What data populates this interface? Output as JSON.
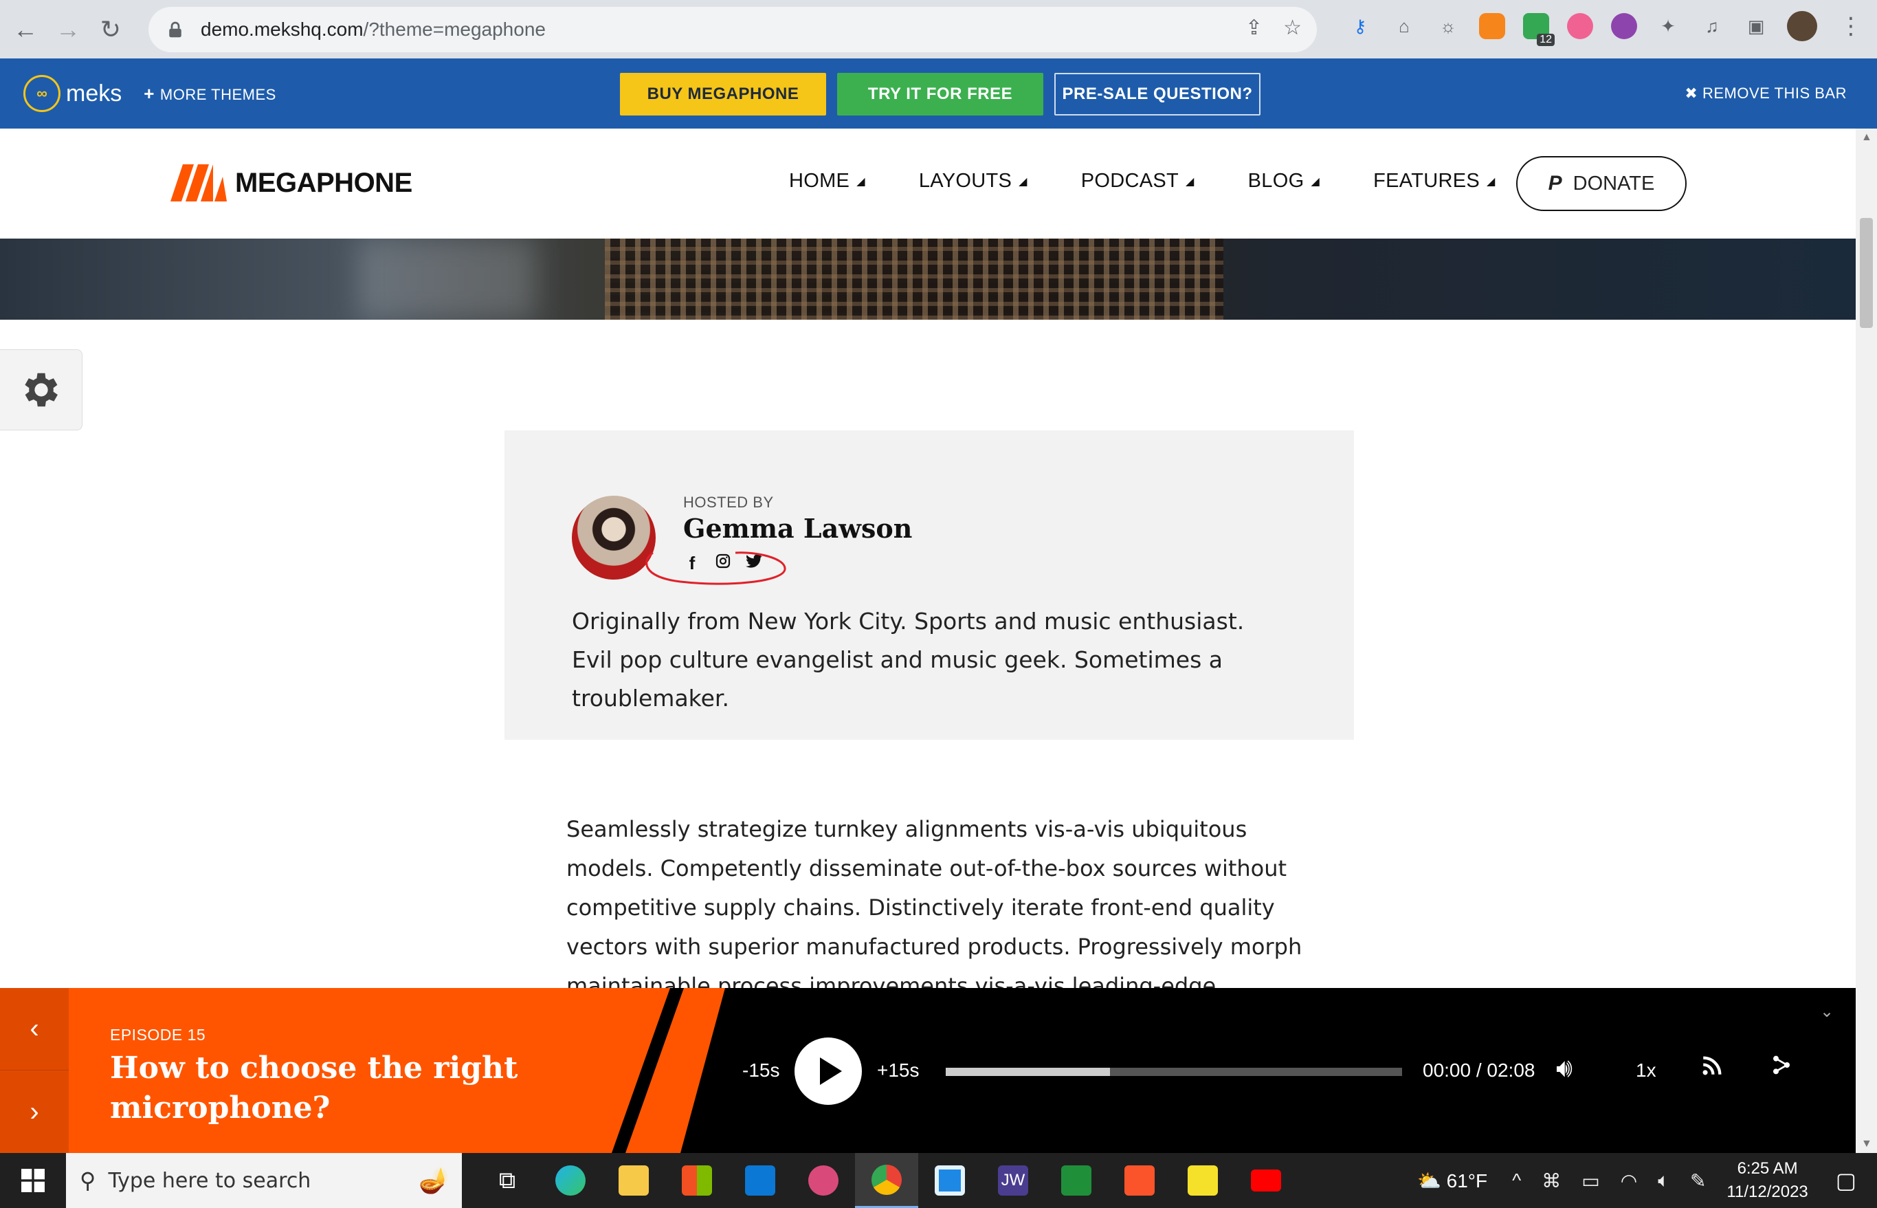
{
  "browser": {
    "url_host": "demo.mekshq.com",
    "url_rest": "/?theme=megaphone",
    "extension_badge": "12"
  },
  "meks_bar": {
    "brand": "meks",
    "more_themes": "MORE THEMES",
    "buy": "BUY MEGAPHONE",
    "try": "TRY IT FOR FREE",
    "presale": "PRE-SALE QUESTION?",
    "remove": "REMOVE THIS BAR"
  },
  "site": {
    "logo_text": "MEGAPHONE",
    "nav": [
      "HOME",
      "LAYOUTS",
      "PODCAST",
      "BLOG",
      "FEATURES"
    ],
    "donate": "DONATE"
  },
  "host": {
    "hosted_by": "HOSTED BY",
    "name": "Gemma Lawson",
    "bio": "Originally from New York City. Sports and music enthusiast. Evil pop culture evangelist and music geek. Sometimes a troublemaker."
  },
  "article": {
    "text": "Seamlessly strategize turnkey alignments vis-a-vis ubiquitous models. Competently disseminate out-of-the-box sources without competitive supply chains. Distinctively iterate front-end quality vectors with superior manufactured products. Progressively morph maintainable process improvements vis-a-vis leading-edge materials. Objectively"
  },
  "player": {
    "episode_label": "EPISODE 15",
    "episode_title": "How to choose the right microphone?",
    "skip_back": "-15s",
    "skip_forward": "+15s",
    "time": "00:00 / 02:08",
    "speed": "1x",
    "buffered_fraction": 0.36
  },
  "taskbar": {
    "search_placeholder": "Type here to search",
    "weather": "61°F",
    "time": "6:25 AM",
    "date": "11/12/2023",
    "app_jw_label": "JW"
  },
  "colors": {
    "meks_blue": "#1e5cab",
    "buy_yellow": "#f5c518",
    "try_green": "#3cb04f",
    "accent_orange": "#ff5500"
  }
}
